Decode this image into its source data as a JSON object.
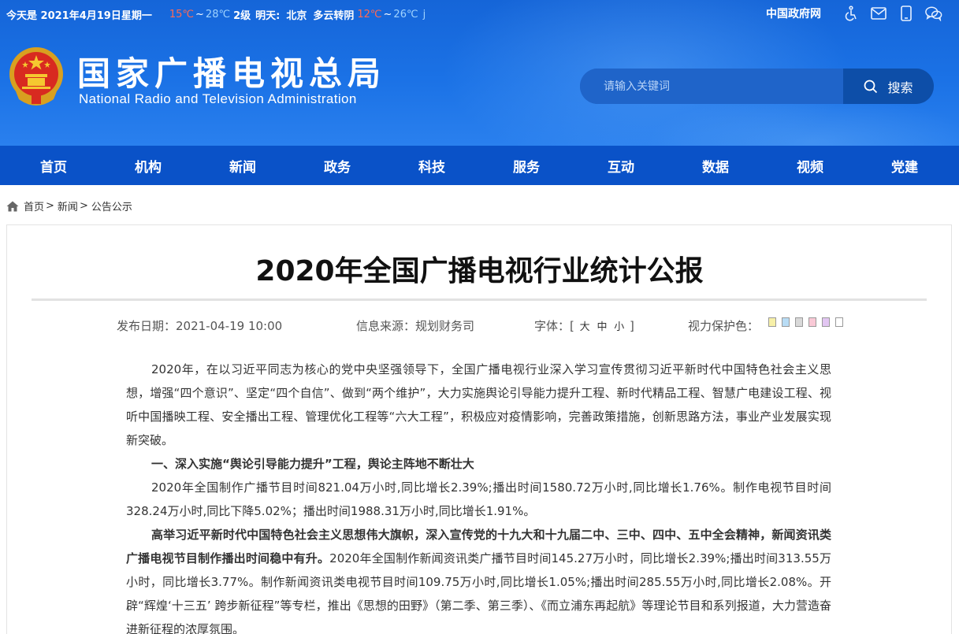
{
  "topbar": {
    "date": "今天是 2021年4月19日星期一",
    "today_low": "15℃",
    "tilde": "~",
    "today_high": "28℃",
    "wind": "2级",
    "tomorrow": "明天:",
    "city": "北京",
    "weather": "多云转阴",
    "tomorrow_low": "12℃",
    "tomorrow_tilde": "~",
    "tomorrow_high": "26℃",
    "cut": "j"
  },
  "toplinks": {
    "gov_link": "中国政府网",
    "icons": [
      "accessibility-icon",
      "mail-icon",
      "mobile-icon",
      "wechat-icon"
    ]
  },
  "brand": {
    "name_cn": "国家广播电视总局",
    "name_en": "National Radio and Television Administration"
  },
  "search": {
    "placeholder": "请输入关键词",
    "button_label": "搜索"
  },
  "nav": {
    "items": [
      "首页",
      "机构",
      "新闻",
      "政务",
      "科技",
      "服务",
      "互动",
      "数据",
      "视频",
      "党建"
    ]
  },
  "breadcrumb": {
    "items": [
      "首页",
      "新闻",
      "公告公示"
    ],
    "sep": ">"
  },
  "article": {
    "title": "2020年全国广播电视行业统计公报",
    "publish_date": "发布日期：2021-04-19 10:00",
    "source": "信息来源：规划财务司",
    "font_label": "字体：[",
    "font_sizes": [
      "大",
      "中",
      "小"
    ],
    "font_close": "]",
    "eye_label": "视力保护色：",
    "eye_colors": [
      "#f7f0a8",
      "#b8dcf5",
      "#d9d9d9",
      "#f9c9d6",
      "#e2c6f2",
      "#ffffff"
    ],
    "paragraphs": {
      "p1": "2020年，在以习近平同志为核心的党中央坚强领导下，全国广播电视行业深入学习宣传贯彻习近平新时代中国特色社会主义思想，增强“四个意识”、坚定“四个自信”、做到“两个维护”，大力实施舆论引导能力提升工程、新时代精品工程、智慧广电建设工程、视听中国播映工程、安全播出工程、管理优化工程等“六大工程”，积极应对疫情影响，完善政策措施，创新思路方法，事业产业发展实现新突破。",
      "h1": "一、深入实施“舆论引导能力提升”工程，舆论主阵地不断壮大",
      "p2": "2020年全国制作广播节目时间821.04万小时,同比增长2.39%;播出时间1580.72万小时,同比增长1.76%。制作电视节目时间328.24万小时,同比下降5.02%；播出时间1988.31万小时,同比增长1.91%。",
      "p3_bold": "高举习近平新时代中国特色社会主义思想伟大旗帜，深入宣传党的十九大和十九届二中、三中、四中、五中全会精神，新闻资讯类广播电视节目制作播出时间稳中有升。",
      "p3_rest": "2020年全国制作新闻资讯类广播节目时间145.27万小时，同比增长2.39%;播出时间313.55万小时，同比增长3.77%。制作新闻资讯类电视节目时间109.75万小时,同比增长1.05%;播出时间285.55万小时,同比增长2.08%。开辟“辉煌‘十三五’ 跨步新征程”等专栏，推出《思想的田野》（第二季、第三季）、《而立浦东再起航》等理论节目和系列报道，大力营造奋进新征程的浓厚氛围。"
    }
  }
}
